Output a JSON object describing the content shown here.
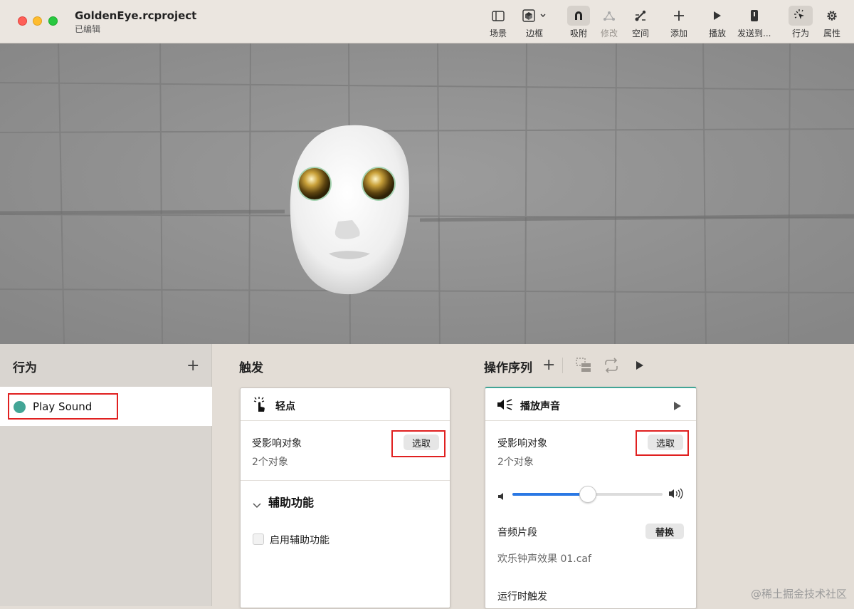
{
  "window": {
    "title": "GoldenEye.rcproject",
    "subtitle": "已编辑"
  },
  "toolbar": {
    "scene": "场景",
    "bounds": "边框",
    "snap": "吸附",
    "modify": "修改",
    "space": "空间",
    "add": "添加",
    "play": "播放",
    "send": "发送到...",
    "behaviors": "行为",
    "properties": "属性"
  },
  "behaviors_panel": {
    "title": "行为",
    "items": [
      {
        "label": "Play Sound",
        "color": "#42a596"
      }
    ]
  },
  "trigger": {
    "section_title": "触发",
    "card_title": "轻点",
    "affected_label": "受影响对象",
    "choose_label": "选取",
    "count": "2个对象",
    "accessibility_title": "辅助功能",
    "accessibility_checkbox": "启用辅助功能"
  },
  "action_sequence": {
    "section_title": "操作序列",
    "card_title": "播放声音",
    "affected_label": "受影响对象",
    "choose_label": "选取",
    "count": "2个对象",
    "volume": 0.5,
    "audio_clip_label": "音频片段",
    "replace_label": "替换",
    "audio_file": "欢乐钟声效果 01.caf",
    "runtime_trigger_label": "运行时触发"
  },
  "watermark": "@稀土掘金技术社区",
  "colors": {
    "accent": "#2a78e4",
    "highlight": "#e02020",
    "behavior_dot": "#42a596"
  }
}
